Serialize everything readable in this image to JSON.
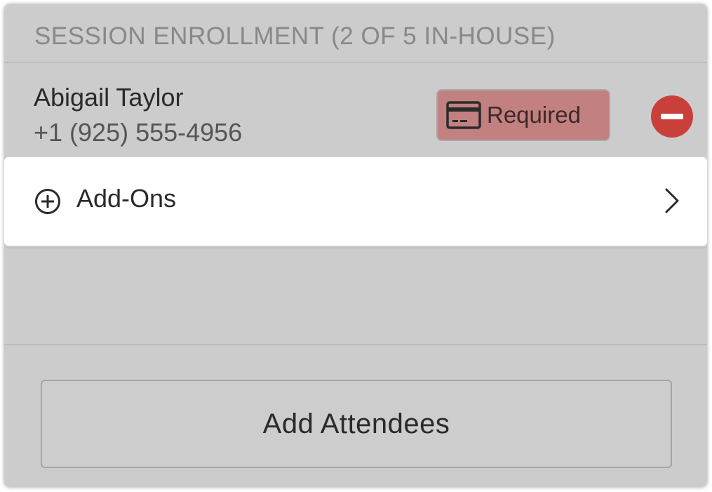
{
  "section": {
    "header": "SESSION ENROLLMENT (2 OF 5 IN-HOUSE)"
  },
  "attendee": {
    "name": "Abigail Taylor",
    "phone": "+1 (925) 555-4956",
    "payment_badge": {
      "icon": "credit-card-icon",
      "label": "Required",
      "color": "#c38080"
    },
    "remove_icon": "minus-circle-icon",
    "remove_color": "#c9403b"
  },
  "addons": {
    "icon": "plus-circle-icon",
    "label": "Add-Ons",
    "chevron_icon": "chevron-right-icon"
  },
  "actions": {
    "add_attendees_label": "Add Attendees"
  }
}
